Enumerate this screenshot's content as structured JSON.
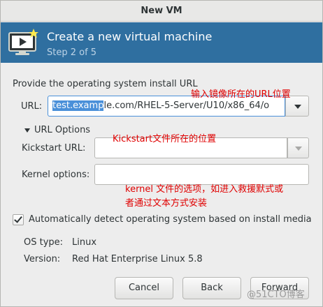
{
  "window": {
    "title": "New VM"
  },
  "banner": {
    "title": "Create a new virtual machine",
    "step": "Step 2 of 5",
    "icon": "monitor-icon"
  },
  "form": {
    "heading": "Provide the operating system install URL",
    "url_label": "URL:",
    "url_value_selected": "test.examp",
    "url_value_rest": "le.com/RHEL-5-Server/U10/x86_64/o",
    "url_options_label": "URL Options",
    "kickstart_label": "Kickstart URL:",
    "kickstart_value": "",
    "kernel_label": "Kernel options:",
    "kernel_value": "",
    "auto_detect_label": "Automatically detect operating system based on install media",
    "auto_detect_checked": true,
    "os_type_label": "OS type:",
    "os_type_value": "Linux",
    "version_label": "Version:",
    "version_value": "Red Hat Enterprise Linux 5.8"
  },
  "buttons": {
    "cancel": "Cancel",
    "back": "Back",
    "forward": "Forward"
  },
  "annotations": {
    "url": "输入镜像所在的URL位置",
    "kickstart": "Kickstart文件所在的位置",
    "kernel_line1": "kernel 文件的选项，如进入救援默式或",
    "kernel_line2": "者通过文本方式安装"
  },
  "watermark": "@51CTO博客",
  "colors": {
    "banner": "#2f6fa0",
    "annotation": "#e00000",
    "selection": "#4a90d9"
  }
}
